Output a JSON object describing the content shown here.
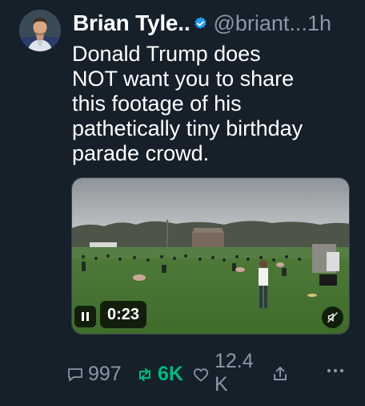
{
  "tweet": {
    "author_name": "Brian Tyle..",
    "handle": "@briant",
    "handle_ellipsis": "...",
    "time": "1h",
    "text": "Donald Trump does\nNOT want you to share\nthis footage of his\npathetically tiny birthday\nparade crowd.",
    "verified": true
  },
  "video": {
    "duration": "0:23",
    "state": "playing",
    "muted": true
  },
  "actions": {
    "replies": "997",
    "retweets": "6K",
    "likes_line1": "12.4",
    "likes_line2": "K"
  },
  "icons": {
    "reply": "reply-icon",
    "retweet": "retweet-icon",
    "like": "heart-icon",
    "share": "share-icon",
    "more": "more-icon",
    "verified": "verified-badge-icon",
    "pause": "pause-icon",
    "mute": "mute-icon"
  },
  "colors": {
    "background": "#15202b",
    "secondary_text": "#8b98a5",
    "verified_blue": "#1d9bf0",
    "retweet_green": "#00ba7c"
  }
}
